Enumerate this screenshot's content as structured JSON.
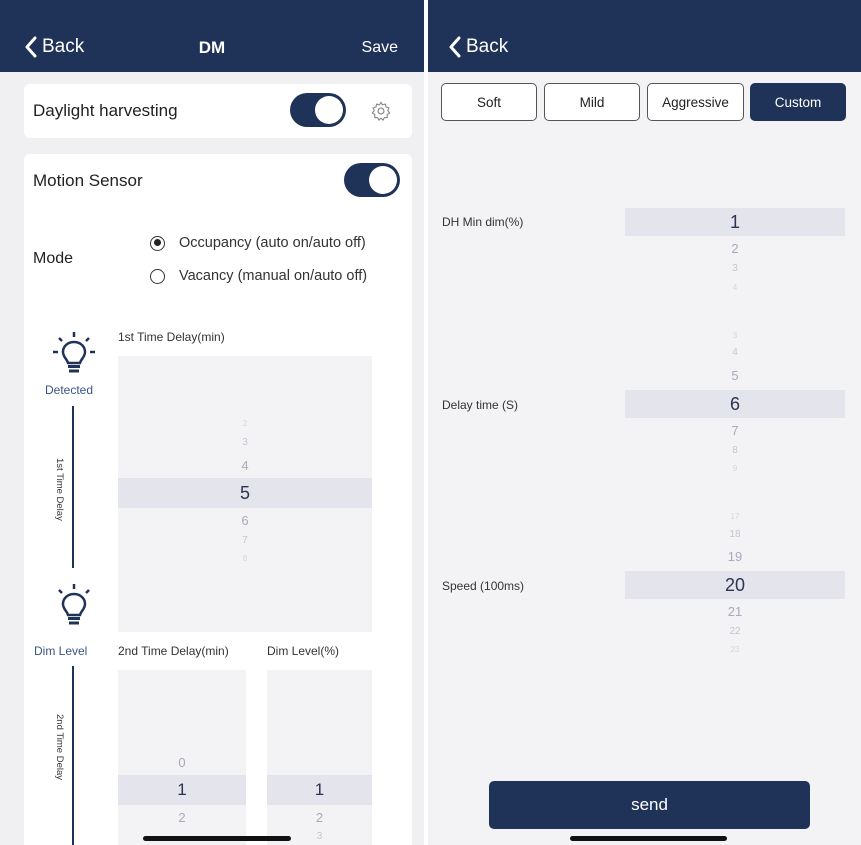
{
  "left": {
    "nav": {
      "back_label": "Back",
      "title": "DM",
      "save_label": "Save"
    },
    "daylight": {
      "label": "Daylight harvesting",
      "enabled": true
    },
    "motion": {
      "label": "Motion Sensor",
      "enabled": true,
      "mode_label": "Mode",
      "options": [
        {
          "label": "Occupancy (auto on/auto off)",
          "selected": true
        },
        {
          "label": "Vacancy (manual on/auto off)",
          "selected": false
        }
      ],
      "detected_label": "Detected",
      "first_delay_vertical": "1st Time Delay",
      "dim_level_label": "Dim Level",
      "second_delay_vertical": "2nd Time Delay",
      "first_delay": {
        "label": "1st Time Delay(min)",
        "items": [
          "2",
          "3",
          "4",
          "5",
          "6",
          "7",
          "8"
        ],
        "selected": "5"
      },
      "second_delay": {
        "label": "2nd Time Delay(min)",
        "items": [
          "0",
          "1",
          "2"
        ],
        "selected": "1"
      },
      "dim_level": {
        "label": "Dim Level(%)",
        "items": [
          "1",
          "2",
          "3"
        ],
        "selected": "1"
      }
    }
  },
  "right": {
    "nav": {
      "back_label": "Back"
    },
    "presets": [
      {
        "label": "Soft",
        "active": false
      },
      {
        "label": "Mild",
        "active": false
      },
      {
        "label": "Aggressive",
        "active": false
      },
      {
        "label": "Custom",
        "active": true
      }
    ],
    "dh_min_dim": {
      "label": "DH Min dim(%)",
      "items": [
        "1",
        "2",
        "3",
        "4"
      ],
      "selected": "1"
    },
    "delay_time": {
      "label": "Delay time (S)",
      "items": [
        "3",
        "4",
        "5",
        "6",
        "7",
        "8",
        "9"
      ],
      "selected": "6"
    },
    "speed": {
      "label": "Speed (100ms)",
      "items": [
        "17",
        "18",
        "19",
        "20",
        "21",
        "22",
        "23"
      ],
      "selected": "20"
    },
    "send_label": "send"
  },
  "colors": {
    "accent": "#1f3358",
    "picker_band": "#e3e4ec",
    "background": "#f0f0f2"
  }
}
